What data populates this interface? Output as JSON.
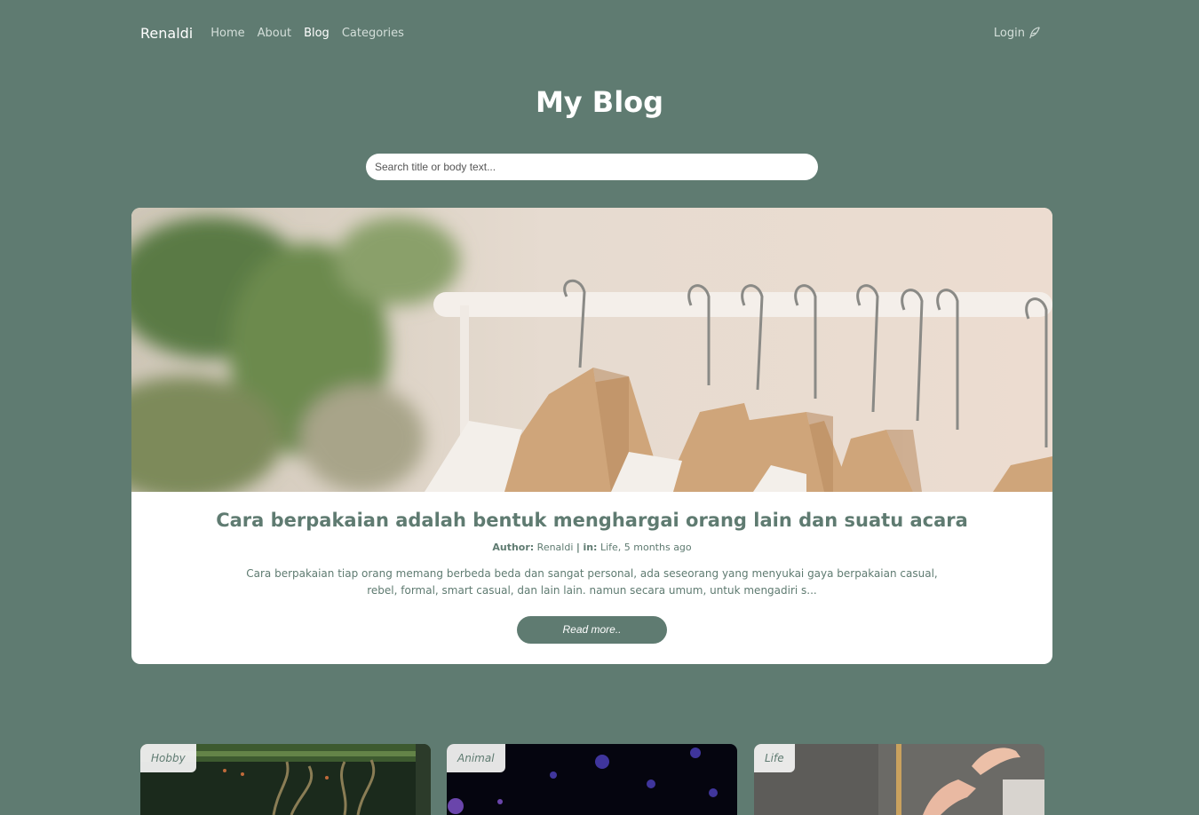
{
  "nav": {
    "brand": "Renaldi",
    "links": [
      {
        "label": "Home"
      },
      {
        "label": "About"
      },
      {
        "label": "Blog"
      },
      {
        "label": "Categories"
      }
    ],
    "active": "Blog",
    "login_label": "Login",
    "login_icon": "feather-icon"
  },
  "page_title": "My Blog",
  "search": {
    "placeholder": "Search title or body text..."
  },
  "featured": {
    "title": "Cara berpakaian adalah bentuk menghargai orang lain dan suatu acara",
    "author_label": "Author:",
    "author": "Renaldi",
    "separator": "|",
    "in_label": "in:",
    "category_and_time": "Life, 5 months ago",
    "excerpt": "Cara berpakaian tiap orang memang berbeda beda dan sangat personal, ada seseorang yang menyukai gaya berpakaian casual, rebel, formal, smart casual, dan lain lain. namun secara umum, untuk mengadiri s...",
    "read_more": "Read more.."
  },
  "cards": [
    {
      "category": "Hobby"
    },
    {
      "category": "Animal"
    },
    {
      "category": "Life"
    }
  ],
  "colors": {
    "background": "#5f7b71",
    "card": "#ffffff",
    "accent": "#5f7b71"
  }
}
